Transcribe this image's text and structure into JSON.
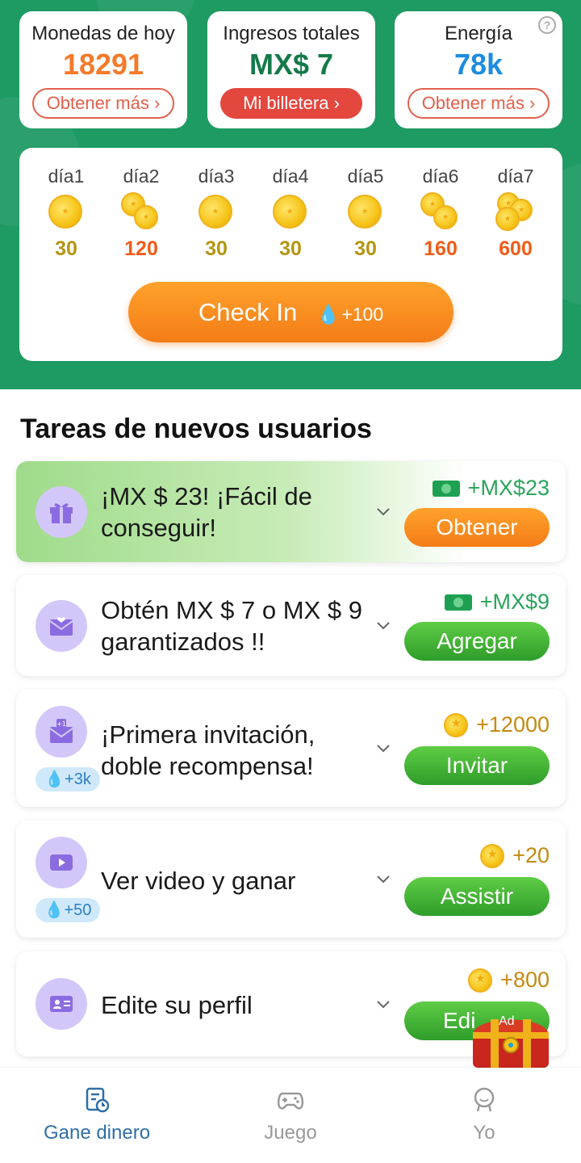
{
  "stats": {
    "coins_today": {
      "title": "Monedas de hoy",
      "value": "18291",
      "button": "Obtener más",
      "color": "#f47a2b"
    },
    "total_income": {
      "title": "Ingresos totales",
      "value": "MX$ 7",
      "button": "Mi billetera",
      "color": "#147a4a"
    },
    "energy": {
      "title": "Energía",
      "value": "78k",
      "button": "Obtener más",
      "color": "#1d8ce0",
      "help": "?"
    }
  },
  "checkin": {
    "days": [
      {
        "label": "día1",
        "amount": "30",
        "color": "#b39612"
      },
      {
        "label": "día2",
        "amount": "120",
        "color": "#f05c18"
      },
      {
        "label": "día3",
        "amount": "30",
        "color": "#b39612"
      },
      {
        "label": "día4",
        "amount": "30",
        "color": "#b39612"
      },
      {
        "label": "día5",
        "amount": "30",
        "color": "#b39612"
      },
      {
        "label": "día6",
        "amount": "160",
        "color": "#f05c18"
      },
      {
        "label": "día7",
        "amount": "600",
        "color": "#f05c18"
      }
    ],
    "button_label": "Check In",
    "button_bonus": "+100"
  },
  "tasks_section": {
    "title": "Tareas de nuevos usuarios",
    "tasks": [
      {
        "text": "¡MX $ 23! ¡Fácil de conseguir!",
        "reward": "+MX$23",
        "button": "Obtener",
        "icon": "gift-icon"
      },
      {
        "text": "Obtén MX $ 7 o MX $ 9 garantizados !!",
        "reward": "+MX$9",
        "button": "Agregar",
        "icon": "envelope-heart-icon"
      },
      {
        "text": "¡Primera invitación, doble recompensa!",
        "reward": "+12000",
        "button": "Invitar",
        "badge": "+3k",
        "icon": "invite-envelope-icon"
      },
      {
        "text": "Ver video y ganar",
        "reward": "+20",
        "button": "Assistir",
        "badge": "+50",
        "icon": "play-icon"
      },
      {
        "text": "Edite su perfil",
        "reward": "+800",
        "button": "Edi",
        "icon": "profile-card-icon"
      }
    ]
  },
  "floating": {
    "chest_label": "Ad",
    "icon": "treasure-chest-icon"
  },
  "nav": {
    "items": [
      {
        "label": "Gane dinero",
        "icon": "earn-icon",
        "active": true
      },
      {
        "label": "Juego",
        "icon": "gamepad-icon",
        "active": false
      },
      {
        "label": "Yo",
        "icon": "person-icon",
        "active": false
      }
    ]
  },
  "colors": {
    "header_green": "#1e9a63",
    "accent_orange": "#f47c17",
    "accent_green": "#2e9d2a",
    "icon_purple": "#d3c7fa"
  }
}
